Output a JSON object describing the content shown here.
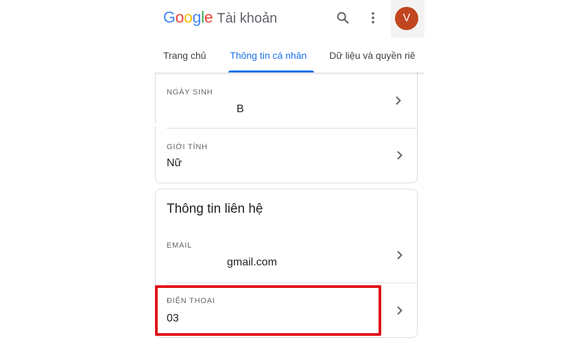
{
  "header": {
    "logo_letters": [
      {
        "ch": "G",
        "color": "#4285F4"
      },
      {
        "ch": "o",
        "color": "#EA4335"
      },
      {
        "ch": "o",
        "color": "#FBBC05"
      },
      {
        "ch": "g",
        "color": "#4285F4"
      },
      {
        "ch": "l",
        "color": "#34A853"
      },
      {
        "ch": "e",
        "color": "#EA4335"
      }
    ],
    "title": "Tài khoản",
    "search_icon": "search-icon",
    "more_icon": "more-vert-icon",
    "avatar_initial": "V",
    "avatar_color": "#C0461F"
  },
  "tabs": [
    {
      "label": "Trang chủ",
      "active": false
    },
    {
      "label": "Thông tin cá nhân",
      "active": true
    },
    {
      "label": "Dữ liệu và quyền riê",
      "active": false
    }
  ],
  "accent_color": "#1A73E8",
  "basic_info": {
    "birthday": {
      "label": "NGÀY SINH",
      "value": "B"
    },
    "gender": {
      "label": "GIỚI TÍNH",
      "value": "Nữ"
    }
  },
  "contact": {
    "title": "Thông tin liên hệ",
    "email": {
      "label": "EMAIL",
      "value": "gmail.com"
    },
    "phone": {
      "label": "ĐIỆN THOẠI",
      "value": "03"
    }
  },
  "highlight_color": "#E0141B"
}
